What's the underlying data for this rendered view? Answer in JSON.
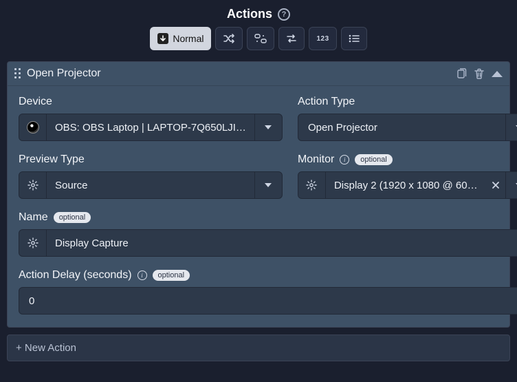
{
  "header": {
    "title": "Actions"
  },
  "modes": {
    "normal": "Normal",
    "shuffle": "shuffle",
    "group": "group",
    "swap": "swap",
    "count123": "123",
    "list": "list"
  },
  "action": {
    "title": "Open Projector",
    "fields": {
      "device_label": "Device",
      "device_value": "OBS: OBS Laptop | LAPTOP-7Q650LJI…",
      "action_type_label": "Action Type",
      "action_type_value": "Open Projector",
      "preview_type_label": "Preview Type",
      "preview_type_value": "Source",
      "monitor_label": "Monitor",
      "monitor_value": "Display 2 (1920 x 1080 @ 60…",
      "monitor_optional": "optional",
      "name_label": "Name",
      "name_optional": "optional",
      "name_value": "Display Capture",
      "delay_label": "Action Delay (seconds)",
      "delay_optional": "optional",
      "delay_value": "0"
    }
  },
  "footer": {
    "new_action": "+ New Action"
  }
}
